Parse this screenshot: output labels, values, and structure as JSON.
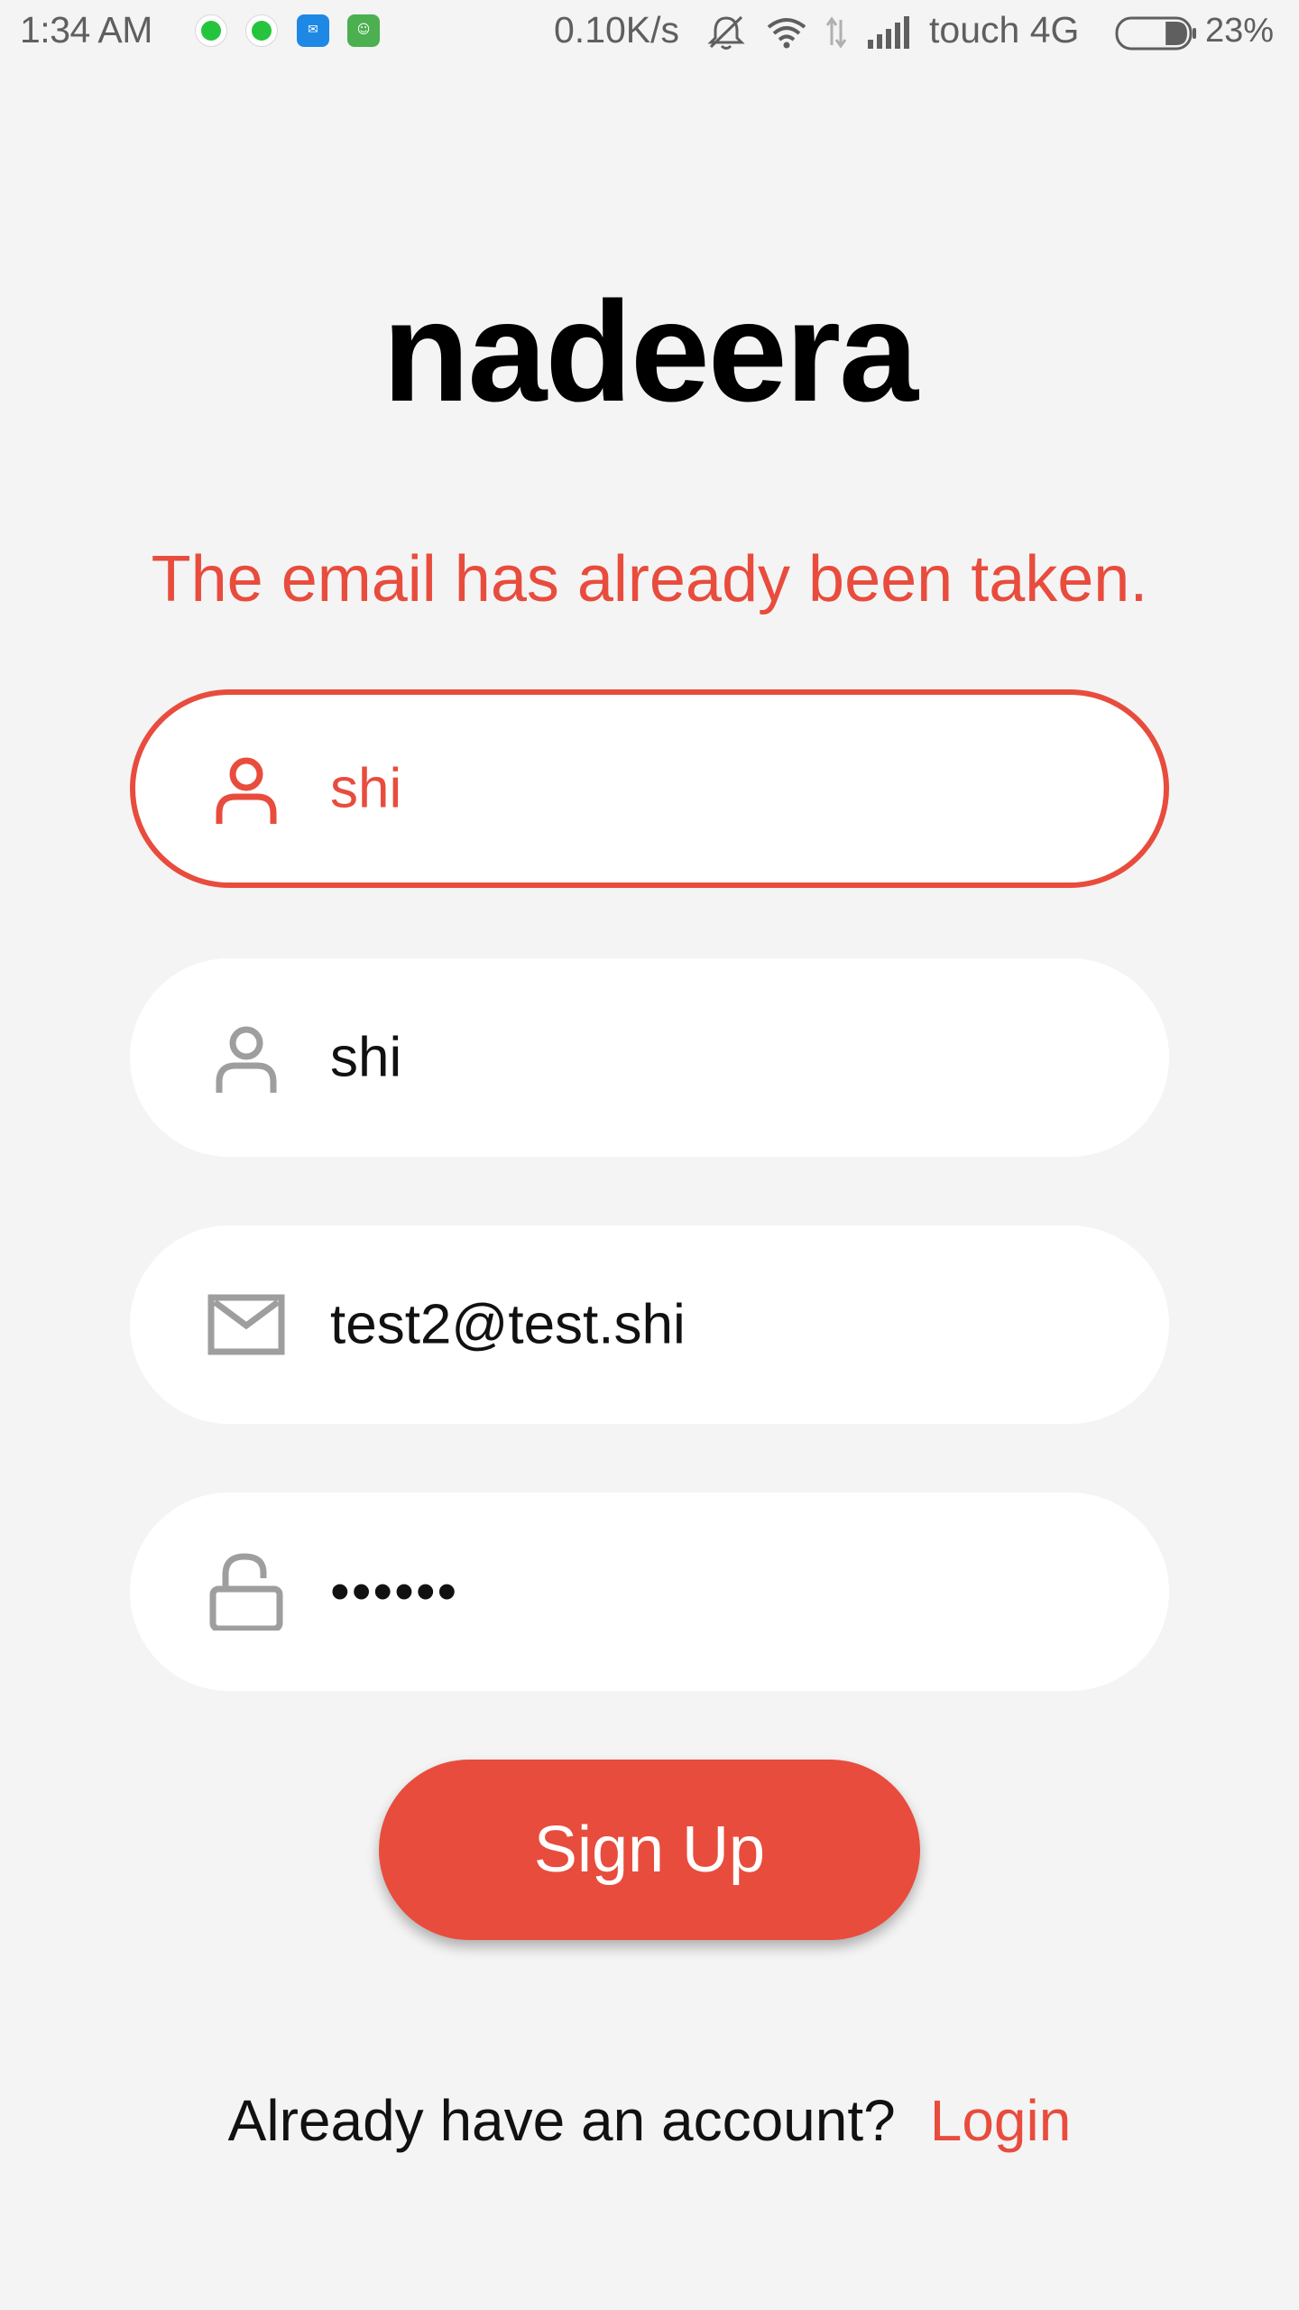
{
  "status_bar": {
    "time": "1:34  AM",
    "net_speed": "0.10K/s",
    "carrier": "touch 4G",
    "battery": "23%",
    "battery_level": 0.23,
    "notification_icons": [
      "whatsapp-icon",
      "whatsapp-icon",
      "blue-app-icon",
      "green-app-icon"
    ],
    "blue_app_label": "✉",
    "green_app_label": "☺"
  },
  "app": {
    "title": "nadeera",
    "error_message": "The email has already been taken."
  },
  "form": {
    "fields": [
      {
        "icon": "person-icon",
        "value": "shi",
        "state": "error"
      },
      {
        "icon": "person-icon",
        "value": "shi",
        "state": "normal"
      },
      {
        "icon": "mail-icon",
        "value": "test2@test.shi",
        "state": "normal"
      },
      {
        "icon": "unlock-icon",
        "value": "••••••",
        "state": "normal"
      }
    ],
    "submit_label": "Sign Up"
  },
  "footer": {
    "question": "Already have an account?",
    "login_label": "Login"
  },
  "colors": {
    "accent": "#e84c3d",
    "background": "#f4f4f4",
    "field_bg": "#ffffff",
    "icon_gray": "#9e9e9e"
  }
}
